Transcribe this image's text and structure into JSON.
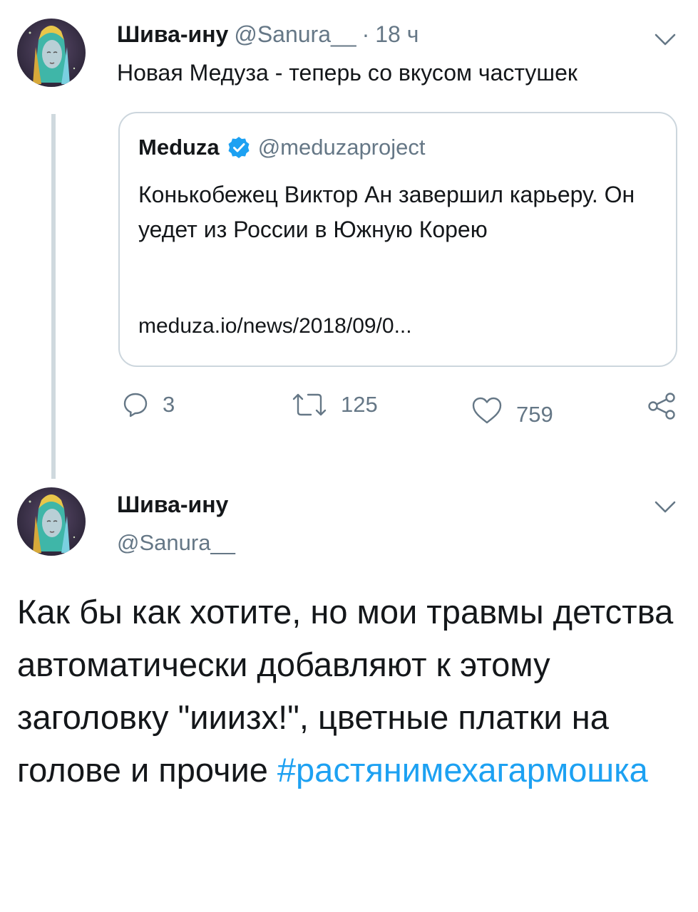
{
  "tweet1": {
    "author_name": "Шива-ину",
    "author_handle": "@Sanura__",
    "separator": "·",
    "time": "18 ч",
    "text": "Новая Медуза - теперь со вкусом частушек",
    "quote": {
      "name": "Meduza",
      "handle": "@meduzaproject",
      "text": "Конькобежец Виктор Ан завершил карьеру. Он уедет из России в Южную Корею",
      "link": "meduza.io/news/2018/09/0..."
    },
    "actions": {
      "replies": "3",
      "retweets": "125",
      "likes": "759"
    }
  },
  "tweet2": {
    "author_name": "Шива-ину",
    "author_handle": "@Sanura__",
    "text": "Как бы как хотите, но мои травмы детства автоматически добавляют к этому заголовку \"ииизх!\", цветные платки на голове и прочие",
    "hashtag": "#растянимехагармошка"
  },
  "colors": {
    "accent": "#1da1f2",
    "secondary_text": "#657786",
    "border": "#ccd6dd",
    "verified": "#1da1f2"
  },
  "icons": [
    "avatar",
    "chevron-down-icon",
    "verified-badge-icon",
    "reply-icon",
    "retweet-icon",
    "like-icon",
    "share-icon"
  ]
}
